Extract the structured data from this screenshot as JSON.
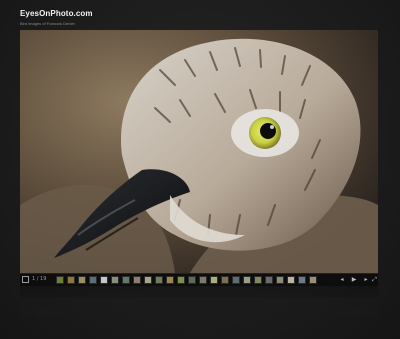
{
  "site": {
    "title": "EyesOnPhoto.com",
    "subtitle": "Bird images of Francois Denier"
  },
  "gallery": {
    "counter": "1 / 19",
    "image_subject": "bird close-up",
    "thumb_colors": [
      "#6b7f35",
      "#8c7a3d",
      "#9b8f5f",
      "#5e6d73",
      "#c3c7c9",
      "#8a8f7e",
      "#65796b",
      "#8d7f6e",
      "#a7a48a",
      "#6f7b5b",
      "#9d8550",
      "#7c8f4b",
      "#5d6b57",
      "#7c7a6e",
      "#aab07a",
      "#7e6f52",
      "#5f6f6f",
      "#9c9c87",
      "#7f8a5c",
      "#6a6a6a",
      "#8d8a76",
      "#b8b59a",
      "#6d7a8a",
      "#9a8f72"
    ],
    "controls": {
      "play": "▶",
      "fullscreen": "⤢",
      "prev": "◂",
      "next": "▸"
    }
  }
}
